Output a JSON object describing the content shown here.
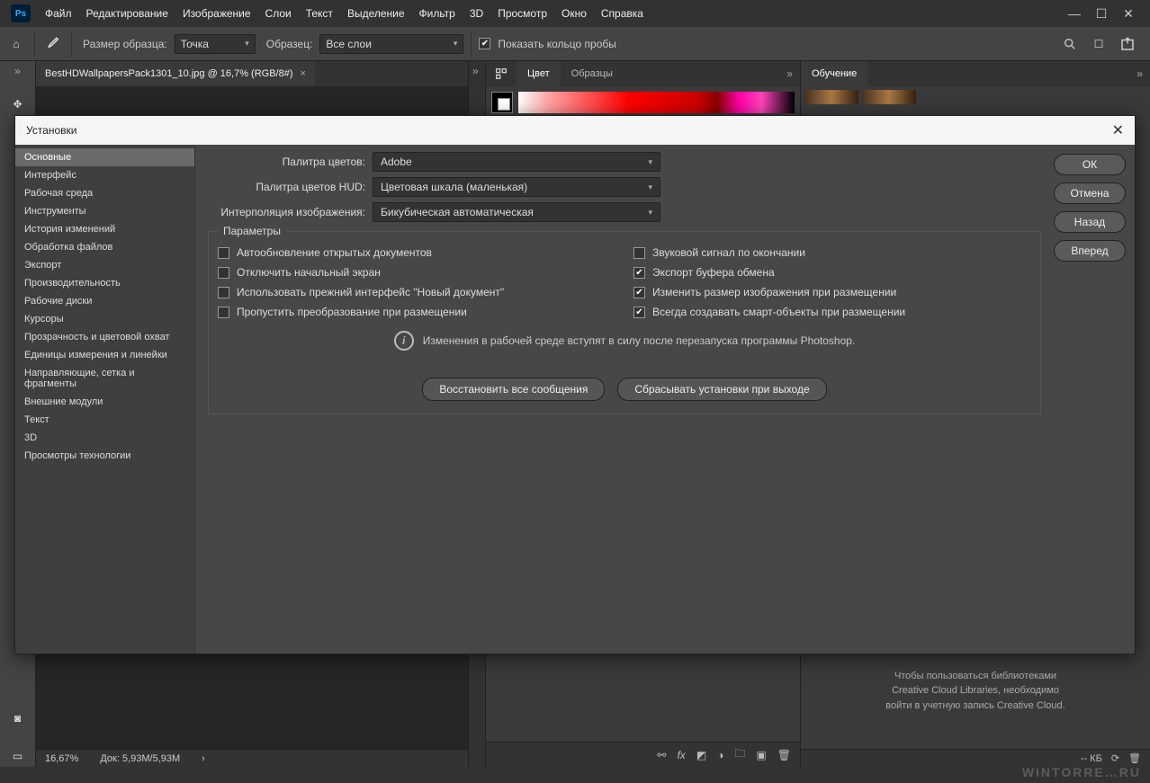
{
  "app": {
    "logo_text": "Ps"
  },
  "menu": [
    "Файл",
    "Редактирование",
    "Изображение",
    "Слои",
    "Текст",
    "Выделение",
    "Фильтр",
    "3D",
    "Просмотр",
    "Окно",
    "Справка"
  ],
  "options_bar": {
    "sample_size_label": "Размер образца:",
    "sample_size_value": "Точка",
    "sample_label": "Образец:",
    "sample_value": "Все слои",
    "show_ring_label": "Показать кольцо пробы",
    "show_ring_checked": true
  },
  "doc": {
    "tab_title": "BestHDWallpapersPack1301_10.jpg @ 16,7% (RGB/8#)",
    "zoom": "16,67%",
    "doc_size_label": "Док: 5,93M/5,93M"
  },
  "color_panel": {
    "tabs": [
      "Цвет",
      "Образцы"
    ]
  },
  "learn_panel": {
    "tab": "Обучение"
  },
  "library_msg": {
    "line1": "Чтобы пользоваться библиотеками",
    "line2": "Creative Cloud Libraries, необходимо",
    "line3": "войти в учетную запись Creative Cloud."
  },
  "lib_status": "-- КБ",
  "watermark": "WINTORRE…RU",
  "dialog": {
    "title": "Установки",
    "categories": [
      "Основные",
      "Интерфейс",
      "Рабочая среда",
      "Инструменты",
      "История изменений",
      "Обработка файлов",
      "Экспорт",
      "Производительность",
      "Рабочие диски",
      "Курсоры",
      "Прозрачность и цветовой охват",
      "Единицы измерения и линейки",
      "Направляющие, сетка и фрагменты",
      "Внешние модули",
      "Текст",
      "3D",
      "Просмотры технологии"
    ],
    "active_category": 0,
    "rows": {
      "picker_label": "Палитра цветов:",
      "picker_value": "Adobe",
      "hud_label": "Палитра цветов HUD:",
      "hud_value": "Цветовая шкала (маленькая)",
      "interp_label": "Интерполяция изображения:",
      "interp_value": "Бикубическая автоматическая"
    },
    "params_legend": "Параметры",
    "params_left": [
      {
        "label": "Автообновление открытых документов",
        "checked": false
      },
      {
        "label": "Отключить начальный экран",
        "checked": false
      },
      {
        "label": "Использовать прежний интерфейс \"Новый документ\"",
        "checked": false
      },
      {
        "label": "Пропустить преобразование при размещении",
        "checked": false
      }
    ],
    "params_right": [
      {
        "label": "Звуковой сигнал по окончании",
        "checked": false
      },
      {
        "label": "Экспорт буфера обмена",
        "checked": true
      },
      {
        "label": "Изменить размер изображения при размещении",
        "checked": true
      },
      {
        "label": "Всегда создавать смарт-объекты при размещении",
        "checked": true
      }
    ],
    "info_text": "Изменения в рабочей среде вступят в силу после перезапуска программы Photoshop.",
    "reset_msgs_btn": "Восстановить все сообщения",
    "reset_on_quit_btn": "Сбрасывать установки при выходе",
    "buttons": {
      "ok": "ОК",
      "cancel": "Отмена",
      "prev": "Назад",
      "next": "Вперед"
    }
  }
}
